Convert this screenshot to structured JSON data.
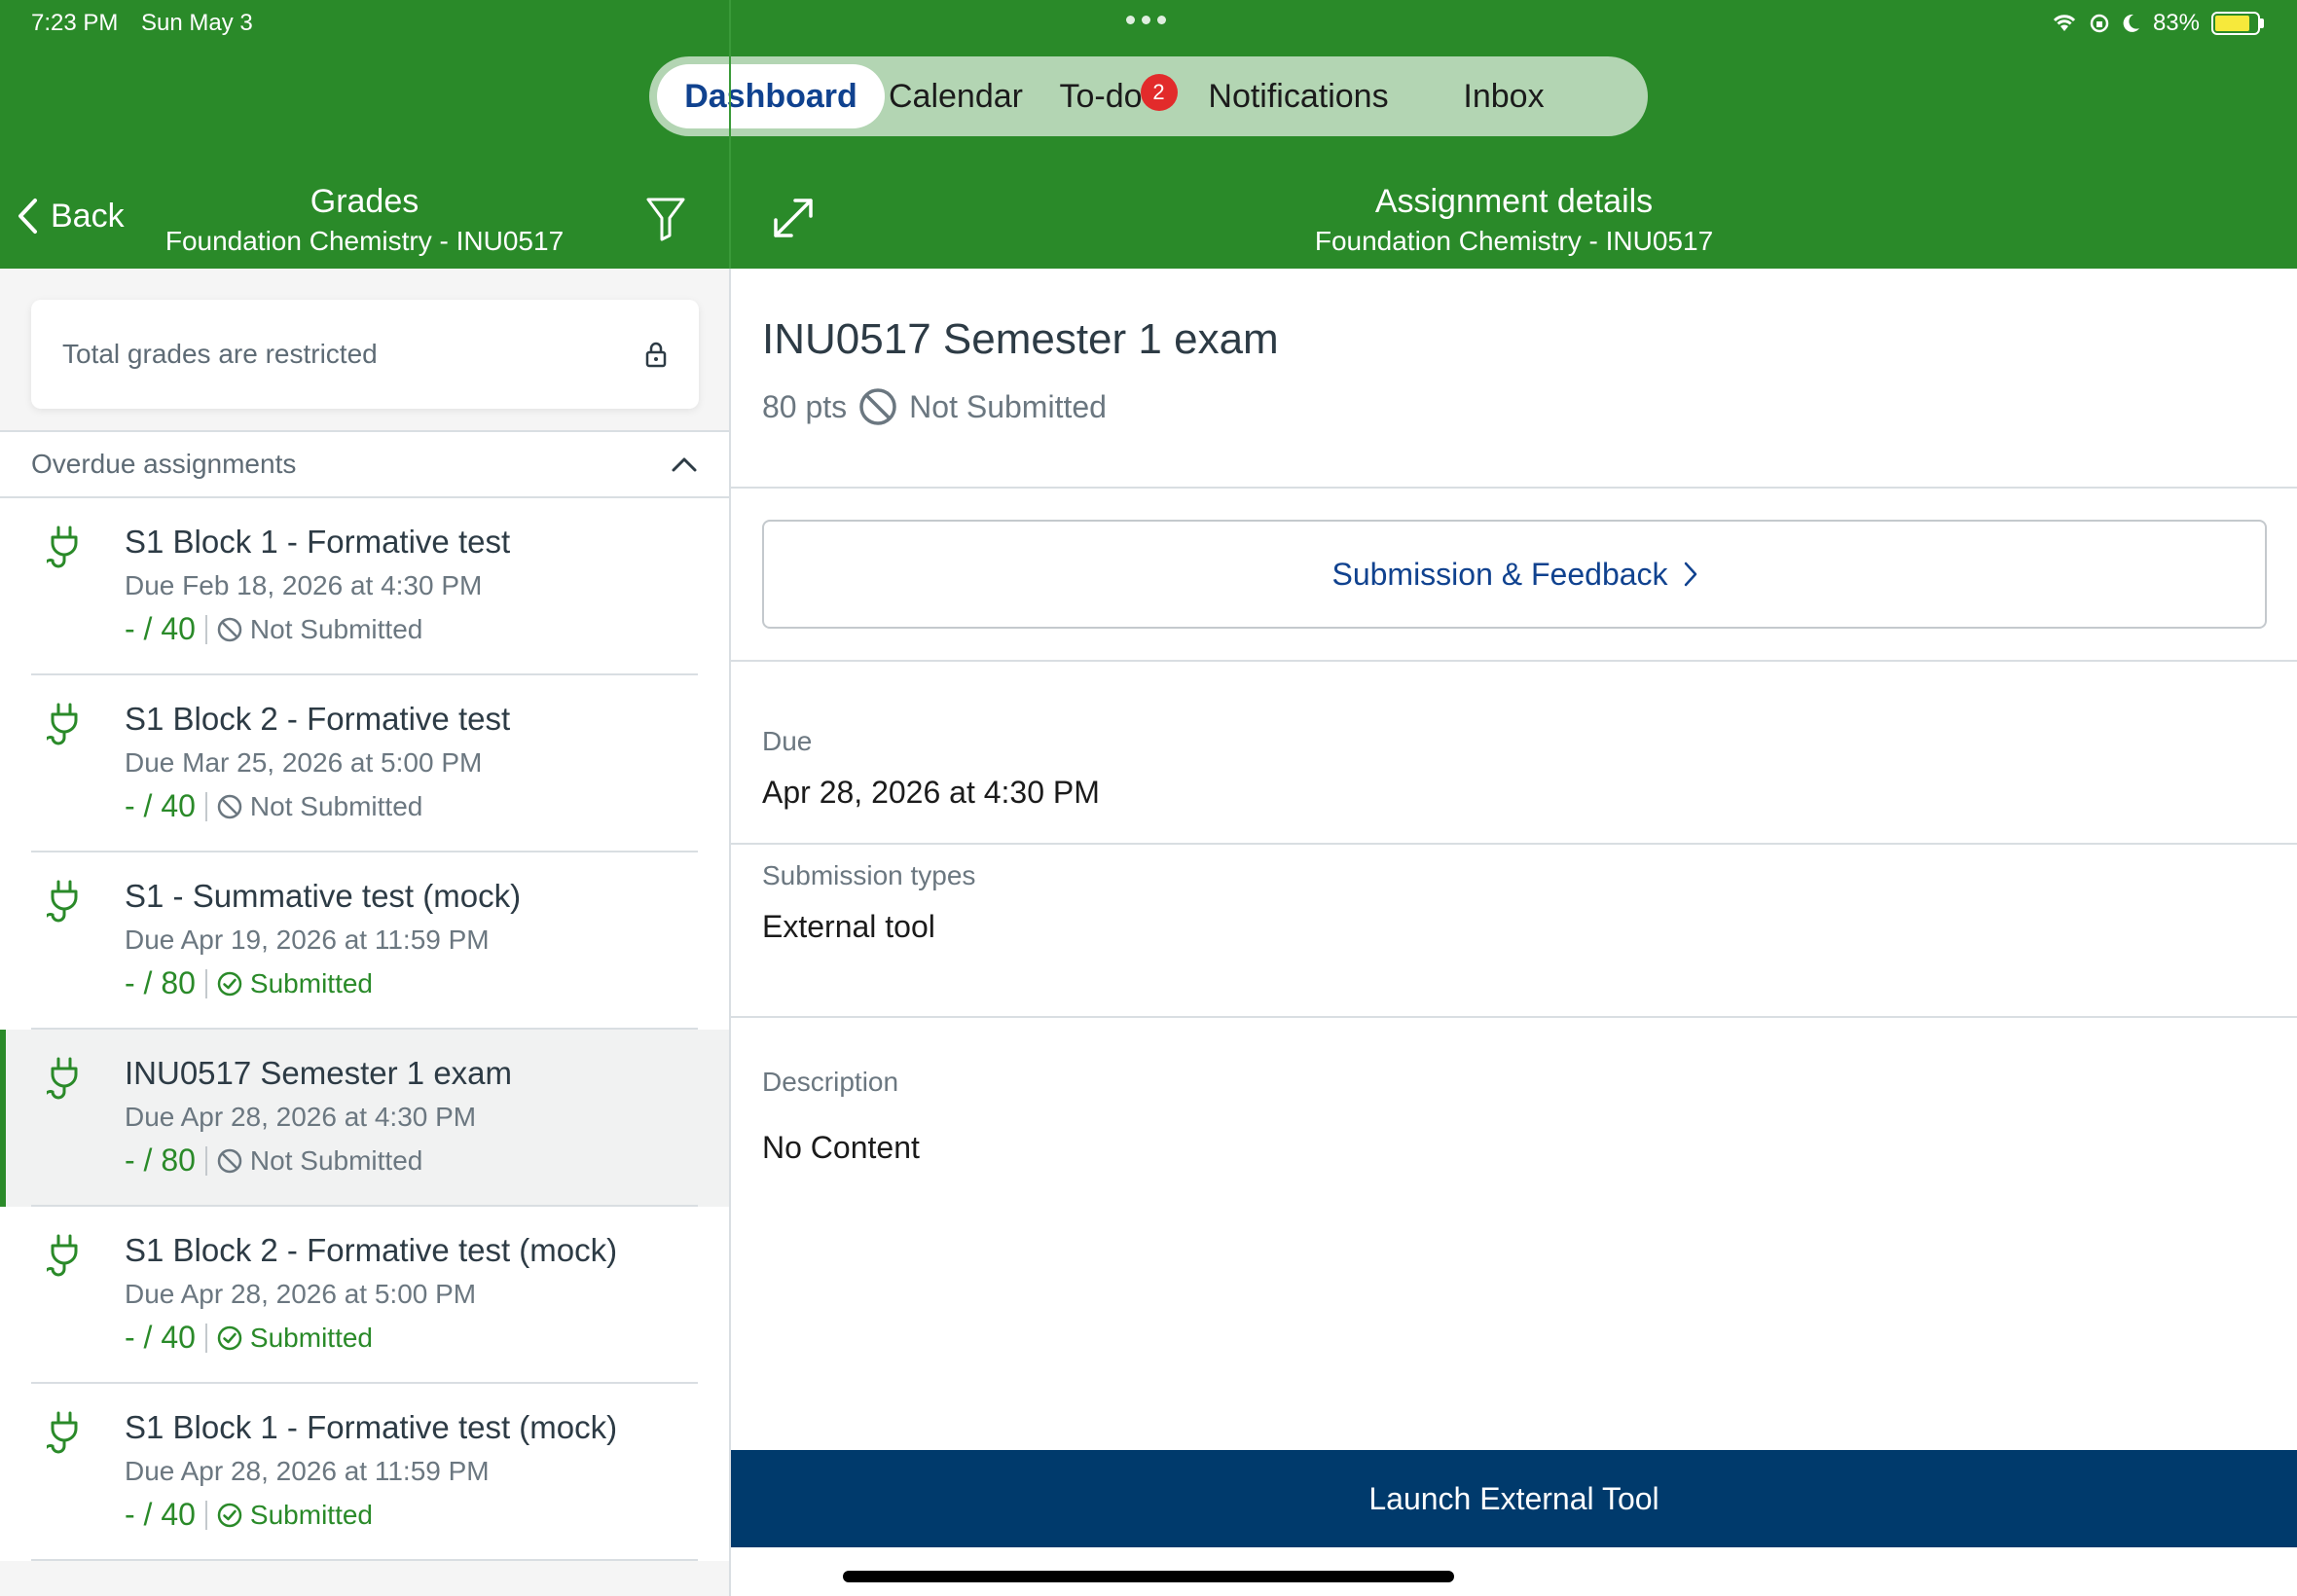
{
  "status": {
    "time": "7:23 PM",
    "date": "Sun May 3",
    "battery": "83%",
    "battery_level": 0.83
  },
  "tabs": [
    {
      "label": "Dashboard",
      "active": true
    },
    {
      "label": "Calendar"
    },
    {
      "label": "To-do",
      "badge": "2"
    },
    {
      "label": "Notifications"
    },
    {
      "label": "Inbox"
    }
  ],
  "left_header": {
    "back": "Back",
    "title": "Grades",
    "subtitle": "Foundation Chemistry - INU0517"
  },
  "right_header": {
    "title": "Assignment details",
    "subtitle": "Foundation Chemistry - INU0517"
  },
  "restricted_text": "Total grades are restricted",
  "section_title": "Overdue assignments",
  "assignments": [
    {
      "title": "S1 Block 1 - Formative test",
      "due": "Due Feb 18, 2026 at 4:30 PM",
      "score": "- / 40",
      "status": "Not Submitted",
      "submitted": false
    },
    {
      "title": "S1 Block 2 - Formative test",
      "due": "Due Mar 25, 2026 at 5:00 PM",
      "score": "- / 40",
      "status": "Not Submitted",
      "submitted": false
    },
    {
      "title": "S1 - Summative test (mock)",
      "due": "Due Apr 19, 2026 at 11:59 PM",
      "score": "- / 80",
      "status": "Submitted",
      "submitted": true
    },
    {
      "title": "INU0517 Semester 1 exam",
      "due": "Due Apr 28, 2026 at 4:30 PM",
      "score": "- / 80",
      "status": "Not Submitted",
      "submitted": false,
      "selected": true
    },
    {
      "title": "S1 Block 2 - Formative test (mock)",
      "due": "Due Apr 28, 2026 at 5:00 PM",
      "score": "- / 40",
      "status": "Submitted",
      "submitted": true
    },
    {
      "title": "S1 Block 1 - Formative test (mock)",
      "due": "Due Apr 28, 2026 at 11:59 PM",
      "score": "- / 40",
      "status": "Submitted",
      "submitted": true
    }
  ],
  "detail": {
    "title": "INU0517 Semester 1 exam",
    "points": "80 pts",
    "status": "Not Submitted",
    "submission_button": "Submission & Feedback",
    "due_label": "Due",
    "due_value": "Apr 28, 2026 at 4:30 PM",
    "types_label": "Submission types",
    "types_value": "External tool",
    "description_label": "Description",
    "description_value": "No Content",
    "launch_button": "Launch External Tool"
  },
  "colors": {
    "brand_green": "#2a8a29",
    "tab_active_text": "#10428f",
    "launch_button": "#003a6c",
    "badge": "#e22b2b"
  }
}
